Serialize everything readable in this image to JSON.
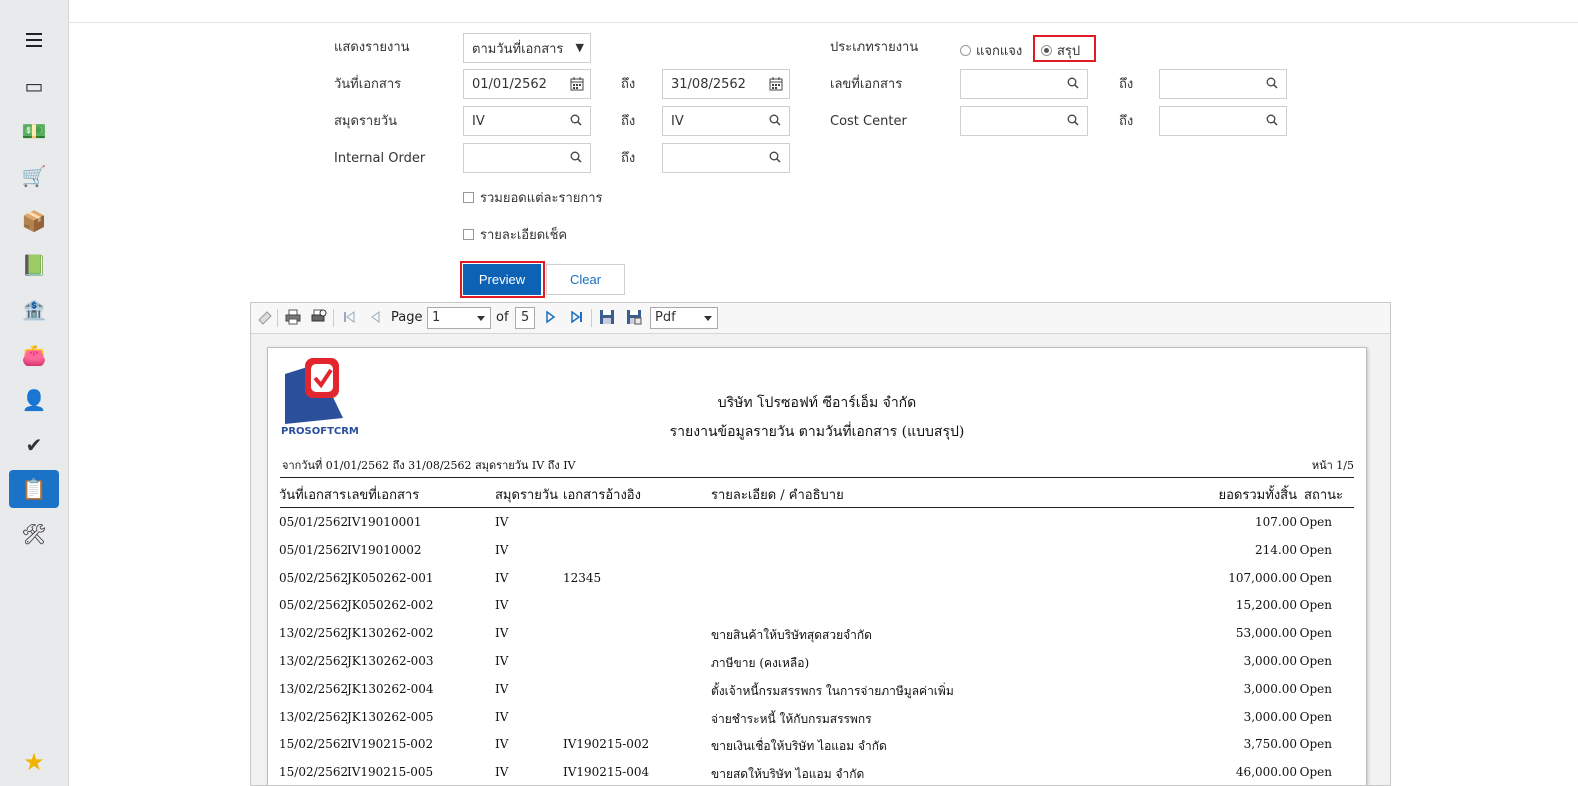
{
  "sidebar": {
    "items": [
      {
        "icon": "dashboard-icon",
        "glyph": "▭"
      },
      {
        "icon": "money-icon",
        "glyph": "💵"
      },
      {
        "icon": "cart-icon",
        "glyph": "🛒"
      },
      {
        "icon": "box-icon",
        "glyph": "📦"
      },
      {
        "icon": "book-icon",
        "glyph": "📗"
      },
      {
        "icon": "bank-icon",
        "glyph": "🏦"
      },
      {
        "icon": "wallet-icon",
        "glyph": "👛"
      },
      {
        "icon": "user-icon",
        "glyph": "👤"
      },
      {
        "icon": "check-icon",
        "glyph": "✔"
      },
      {
        "icon": "report-icon",
        "glyph": "📋"
      },
      {
        "icon": "tools-icon",
        "glyph": "🛠"
      }
    ],
    "favorite_glyph": "★"
  },
  "form": {
    "show_report_label": "แสดงรายงาน",
    "show_report_value": "ตามวันที่เอกสาร",
    "report_type_label": "ประเภทรายงาน",
    "radio_detail": "แจกแจง",
    "radio_summary": "สรุป",
    "doc_date_label": "วันที่เอกสาร",
    "doc_date_from": "01/01/2562",
    "doc_date_to": "31/08/2562",
    "to_label": "ถึง",
    "doc_no_label": "เลขที่เอกสาร",
    "journal_label": "สมุดรายวัน",
    "journal_from": "IV",
    "journal_to": "IV",
    "cost_center_label": "Cost Center",
    "internal_order_label": "Internal Order",
    "chk_sum_each": "รวมยอดแต่ละรายการ",
    "chk_cheque_detail": "รายละเอียดเช็ค",
    "preview": "Preview",
    "clear": "Clear"
  },
  "toolbar": {
    "page_label": "Page",
    "page_value": "1",
    "of_label": "of",
    "total_pages": "5",
    "format": "Pdf"
  },
  "report": {
    "logo_text": "PROSOFTCRM",
    "company": "บริษัท โปรซอฟท์ ซีอาร์เอ็ม จำกัด",
    "title": "รายงานข้อมูลรายวัน ตามวันที่เอกสาร (แบบสรุป)",
    "criteria": "จากวันที่ 01/01/2562 ถึง 31/08/2562 สมุดรายวัน IV ถึง IV",
    "page_info": "หน้า 1/5",
    "columns": {
      "date": "วันที่เอกสาร",
      "doc_no": "เลขที่เอกสาร",
      "journal": "สมุดรายวัน",
      "ref": "เอกสารอ้างอิง",
      "desc": "รายละเอียด / คำอธิบาย",
      "total": "ยอดรวมทั้งสิ้น",
      "status": "สถานะ"
    },
    "rows": [
      {
        "date": "05/01/2562",
        "doc_no": "IV19010001",
        "journal": "IV",
        "ref": "",
        "desc": "",
        "total": "107.00",
        "status": "Open"
      },
      {
        "date": "05/01/2562",
        "doc_no": "IV19010002",
        "journal": "IV",
        "ref": "",
        "desc": "",
        "total": "214.00",
        "status": "Open"
      },
      {
        "date": "05/02/2562",
        "doc_no": "JK050262-001",
        "journal": "IV",
        "ref": "12345",
        "desc": "",
        "total": "107,000.00",
        "status": "Open"
      },
      {
        "date": "05/02/2562",
        "doc_no": "JK050262-002",
        "journal": "IV",
        "ref": "",
        "desc": "",
        "total": "15,200.00",
        "status": "Open"
      },
      {
        "date": "13/02/2562",
        "doc_no": "JK130262-002",
        "journal": "IV",
        "ref": "",
        "desc": "ขายสินค้าให้บริษัทสุดสวยจำกัด",
        "total": "53,000.00",
        "status": "Open"
      },
      {
        "date": "13/02/2562",
        "doc_no": "JK130262-003",
        "journal": "IV",
        "ref": "",
        "desc": "ภาษีขาย (คงเหลือ)",
        "total": "3,000.00",
        "status": "Open"
      },
      {
        "date": "13/02/2562",
        "doc_no": "JK130262-004",
        "journal": "IV",
        "ref": "",
        "desc": "ตั้งเจ้าหนี้กรมสรรพกร ในการจ่ายภาษีมูลค่าเพิ่ม",
        "total": "3,000.00",
        "status": "Open"
      },
      {
        "date": "13/02/2562",
        "doc_no": "JK130262-005",
        "journal": "IV",
        "ref": "",
        "desc": "จ่ายชำระหนี้ ให้กับกรมสรรพกร",
        "total": "3,000.00",
        "status": "Open"
      },
      {
        "date": "15/02/2562",
        "doc_no": "IV190215-002",
        "journal": "IV",
        "ref": "IV190215-002",
        "desc": "ขายเงินเชื่อให้บริษัท  ไอแอม จำกัด",
        "total": "3,750.00",
        "status": "Open"
      },
      {
        "date": "15/02/2562",
        "doc_no": "IV190215-005",
        "journal": "IV",
        "ref": "IV190215-004",
        "desc": "ขายสดให้บริษัท  ไอแอม จำกัด",
        "total": "46,000.00",
        "status": "Open"
      }
    ]
  }
}
